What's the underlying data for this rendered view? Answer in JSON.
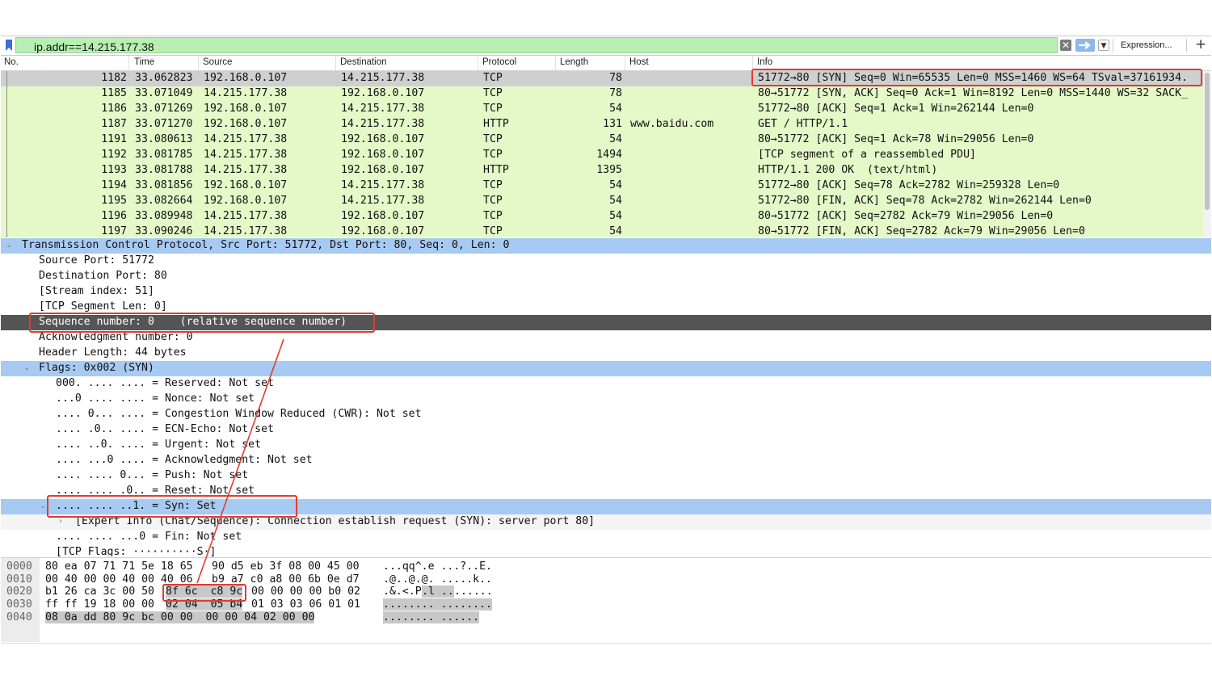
{
  "filter": {
    "value": "ip.addr==14.215.177.38",
    "expression_label": "Expression...",
    "plus_label": "+"
  },
  "columns": [
    "No.",
    "Time",
    "Source",
    "Destination",
    "Protocol",
    "Length",
    "Host",
    "Info"
  ],
  "packets": [
    {
      "no": "1182",
      "time": "33.062823",
      "src": "192.168.0.107",
      "dst": "14.215.177.38",
      "proto": "TCP",
      "len": "78",
      "host": "",
      "info": "51772→80 [SYN] Seq=0 Win=65535 Len=0 MSS=1460 WS=64 TSval=37161934."
    },
    {
      "no": "1185",
      "time": "33.071049",
      "src": "14.215.177.38",
      "dst": "192.168.0.107",
      "proto": "TCP",
      "len": "78",
      "host": "",
      "info": "80→51772 [SYN, ACK] Seq=0 Ack=1 Win=8192 Len=0 MSS=1440 WS=32 SACK_"
    },
    {
      "no": "1186",
      "time": "33.071269",
      "src": "192.168.0.107",
      "dst": "14.215.177.38",
      "proto": "TCP",
      "len": "54",
      "host": "",
      "info": "51772→80 [ACK] Seq=1 Ack=1 Win=262144 Len=0"
    },
    {
      "no": "1187",
      "time": "33.071270",
      "src": "192.168.0.107",
      "dst": "14.215.177.38",
      "proto": "HTTP",
      "len": "131",
      "host": "www.baidu.com",
      "info": "GET / HTTP/1.1"
    },
    {
      "no": "1191",
      "time": "33.080613",
      "src": "14.215.177.38",
      "dst": "192.168.0.107",
      "proto": "TCP",
      "len": "54",
      "host": "",
      "info": "80→51772 [ACK] Seq=1 Ack=78 Win=29056 Len=0"
    },
    {
      "no": "1192",
      "time": "33.081785",
      "src": "14.215.177.38",
      "dst": "192.168.0.107",
      "proto": "TCP",
      "len": "1494",
      "host": "",
      "info": "[TCP segment of a reassembled PDU]"
    },
    {
      "no": "1193",
      "time": "33.081788",
      "src": "14.215.177.38",
      "dst": "192.168.0.107",
      "proto": "HTTP",
      "len": "1395",
      "host": "",
      "info": "HTTP/1.1 200 OK  (text/html)"
    },
    {
      "no": "1194",
      "time": "33.081856",
      "src": "192.168.0.107",
      "dst": "14.215.177.38",
      "proto": "TCP",
      "len": "54",
      "host": "",
      "info": "51772→80 [ACK] Seq=78 Ack=2782 Win=259328 Len=0"
    },
    {
      "no": "1195",
      "time": "33.082664",
      "src": "192.168.0.107",
      "dst": "14.215.177.38",
      "proto": "TCP",
      "len": "54",
      "host": "",
      "info": "51772→80 [FIN, ACK] Seq=78 Ack=2782 Win=262144 Len=0"
    },
    {
      "no": "1196",
      "time": "33.089948",
      "src": "14.215.177.38",
      "dst": "192.168.0.107",
      "proto": "TCP",
      "len": "54",
      "host": "",
      "info": "80→51772 [ACK] Seq=2782 Ack=79 Win=29056 Len=0"
    },
    {
      "no": "1197",
      "time": "33.090246",
      "src": "14.215.177.38",
      "dst": "192.168.0.107",
      "proto": "TCP",
      "len": "54",
      "host": "",
      "info": "80→51772 [FIN, ACK] Seq=2782 Ack=79 Win=29056 Len=0"
    }
  ],
  "details": [
    {
      "text": "Transmission Control Protocol, Src Port: 51772, Dst Port: 80, Seq: 0, Len: 0"
    },
    {
      "text": "Source Port: 51772"
    },
    {
      "text": "Destination Port: 80"
    },
    {
      "text": "[Stream index: 51]"
    },
    {
      "text": "[TCP Segment Len: 0]"
    },
    {
      "text": "Sequence number: 0    (relative sequence number)"
    },
    {
      "text": "Acknowledgment number: 0"
    },
    {
      "text": "Header Length: 44 bytes"
    },
    {
      "text": "Flags: 0x002 (SYN)"
    },
    {
      "text": "000. .... .... = Reserved: Not set"
    },
    {
      "text": "...0 .... .... = Nonce: Not set"
    },
    {
      "text": ".... 0... .... = Congestion Window Reduced (CWR): Not set"
    },
    {
      "text": ".... .0.. .... = ECN-Echo: Not set"
    },
    {
      "text": ".... ..0. .... = Urgent: Not set"
    },
    {
      "text": ".... ...0 .... = Acknowledgment: Not set"
    },
    {
      "text": ".... .... 0... = Push: Not set"
    },
    {
      "text": ".... .... .0.. = Reset: Not set"
    },
    {
      "text": ".... .... ..1. = Syn: Set"
    },
    {
      "text": "[Expert Info (Chat/Sequence): Connection establish request (SYN): server port 80]"
    },
    {
      "text": ".... .... ...0 = Fin: Not set"
    },
    {
      "text": "[TCP Flags: ··········S·]"
    }
  ],
  "hex": [
    {
      "offset": "0000",
      "bytes_a": "80 ea 07 71 71 5e 18 65",
      "bytes_b": "90 d5 eb 3f 08 00 45 00",
      "ascii": "...qq^.e ...?..E."
    },
    {
      "offset": "0010",
      "bytes_a": "00 40 00 00 40 00 40 06",
      "bytes_b": "b9 a7 c0 a8 00 6b 0e d7",
      "ascii": ".@..@.@. .....k.."
    },
    {
      "offset": "0020",
      "bytes_a": "b1 26 ca 3c 00 50",
      "bytes_hl": "8f 6c  c8 9c",
      "bytes_c": "00 00 00 00 b0 02",
      "ascii_pre": ".&.<.P",
      "ascii_hl": ".l ..",
      "ascii_post": "......"
    },
    {
      "offset": "0030",
      "bytes_a": "ff ff 19 18 00 00",
      "bytes_hl": "02 04  05 b4",
      "bytes_c": "01 03 03 06 01 01",
      "ascii_hl": "........ ........"
    },
    {
      "offset": "0040",
      "bytes_hl": "08 0a dd 80 9c bc 00 00  00 00 04 02 00 00",
      "ascii_hl": "........ ......"
    }
  ]
}
